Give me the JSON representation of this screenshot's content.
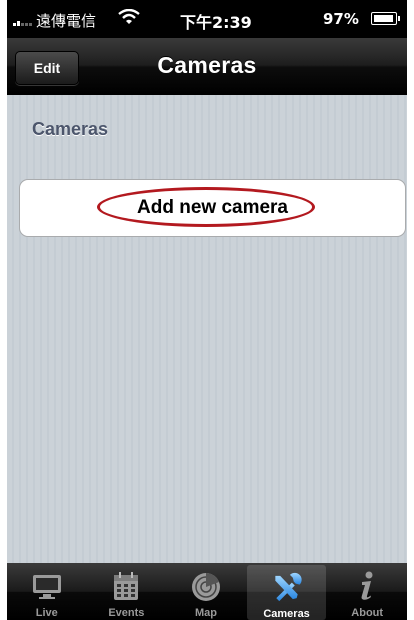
{
  "status_bar": {
    "carrier": "遠傳電信",
    "time": "下午2:39",
    "battery": "97%"
  },
  "nav_bar": {
    "edit_label": "Edit",
    "title": "Cameras"
  },
  "content": {
    "section_header": "Cameras",
    "add_camera_label": "Add new camera",
    "highlight_color": "#b3191f"
  },
  "tab_bar": {
    "selected": "Cameras",
    "tabs": [
      {
        "label": "Live",
        "icon": "monitor-icon"
      },
      {
        "label": "Events",
        "icon": "calendar-icon"
      },
      {
        "label": "Map",
        "icon": "radar-icon"
      },
      {
        "label": "Cameras",
        "icon": "tools-icon"
      },
      {
        "label": "About",
        "icon": "info-icon"
      }
    ]
  }
}
